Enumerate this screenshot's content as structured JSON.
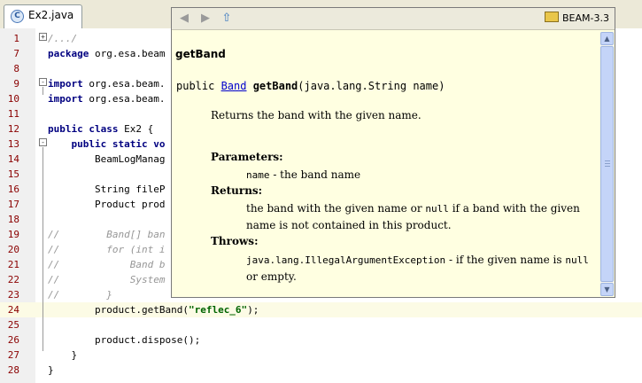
{
  "tab": {
    "icon": "java-class-icon",
    "label": "Ex2.java"
  },
  "editor": {
    "lines": [
      {
        "num": "1",
        "code": "/.../",
        "type": "comment"
      },
      {
        "num": "7",
        "code": "package org.esa.beam",
        "type": "pkg"
      },
      {
        "num": "8",
        "code": "",
        "type": "plain"
      },
      {
        "num": "9",
        "code": "import org.esa.beam.",
        "type": "import"
      },
      {
        "num": "10",
        "code": "import org.esa.beam.",
        "type": "import"
      },
      {
        "num": "11",
        "code": "",
        "type": "plain"
      },
      {
        "num": "12",
        "code": "public class Ex2 {",
        "type": "class"
      },
      {
        "num": "13",
        "code": "    public static vo",
        "type": "method"
      },
      {
        "num": "14",
        "code": "        BeamLogManag",
        "type": "plain"
      },
      {
        "num": "15",
        "code": "",
        "type": "plain"
      },
      {
        "num": "16",
        "code": "        String fileP",
        "type": "plain"
      },
      {
        "num": "17",
        "code": "        Product prod",
        "type": "plain"
      },
      {
        "num": "18",
        "code": "",
        "type": "plain"
      },
      {
        "num": "19",
        "code": "//        Band[] ban",
        "type": "comment"
      },
      {
        "num": "20",
        "code": "//        for (int i",
        "type": "comment"
      },
      {
        "num": "21",
        "code": "//            Band b",
        "type": "comment"
      },
      {
        "num": "22",
        "code": "//            System",
        "type": "comment"
      },
      {
        "num": "23",
        "code": "//        }",
        "type": "comment"
      },
      {
        "num": "24",
        "code": "        product.getBand(",
        "type": "call",
        "arg": "\"reflec_6\"",
        "tail": ");"
      },
      {
        "num": "25",
        "code": "",
        "type": "plain"
      },
      {
        "num": "26",
        "code": "        product.dispose();",
        "type": "plain"
      },
      {
        "num": "27",
        "code": "    }",
        "type": "plain"
      },
      {
        "num": "28",
        "code": "}",
        "type": "plain"
      }
    ]
  },
  "javadoc": {
    "toolbar": {
      "back": "back-arrow-icon",
      "forward": "forward-arrow-icon",
      "source": "go-to-source-icon",
      "library": "BEAM-3.3"
    },
    "title": "getBand",
    "signature": {
      "modifier": "public ",
      "type": "Band",
      "name": " getBand",
      "params": "(java.lang.String name)"
    },
    "description": "Returns the band with the given name.",
    "parameters_heading": "Parameters:",
    "param_name": "name",
    "param_desc": " - the band name",
    "returns_heading": "Returns:",
    "returns_1": "the band with the given name or ",
    "returns_null": "null",
    "returns_2": " if a band with the given name is not contained in this product.",
    "throws_heading": "Throws:",
    "throws_exc": "java.lang.IllegalArgumentException",
    "throws_1": " - if the given name is ",
    "throws_null": "null",
    "throws_2": " or empty."
  }
}
